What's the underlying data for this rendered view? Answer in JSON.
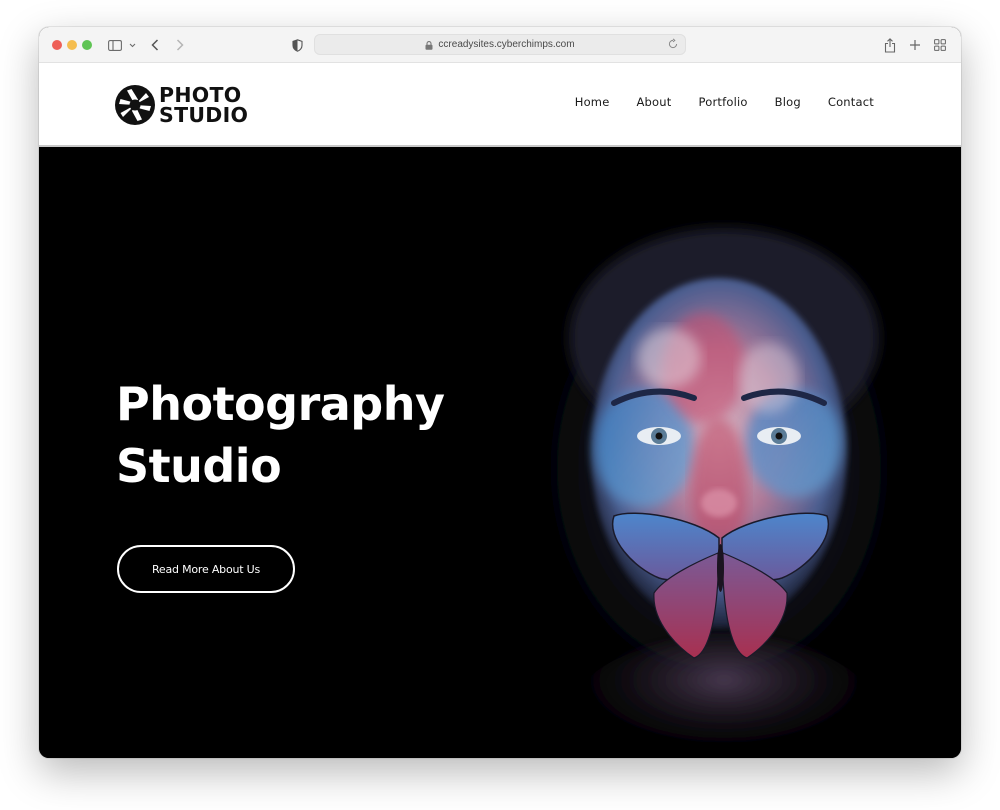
{
  "browser": {
    "url": "ccreadysites.cyberchimps.com",
    "icons": {
      "sidebar": "sidebar-icon",
      "back": "chevron-left-icon",
      "forward": "chevron-right-icon",
      "privacy": "shield-icon",
      "lock": "lock-icon",
      "reload": "reload-icon",
      "share": "share-icon",
      "new_tab": "plus-icon",
      "tab_overview": "grid-icon"
    }
  },
  "header": {
    "logo": {
      "line1": "PHOTO",
      "line2": "STUDIO",
      "icon": "camera-aperture-icon"
    },
    "nav": [
      {
        "label": "Home"
      },
      {
        "label": "About"
      },
      {
        "label": "Portfolio"
      },
      {
        "label": "Blog"
      },
      {
        "label": "Contact"
      }
    ]
  },
  "hero": {
    "title_line1": "Photography",
    "title_line2": "Studio",
    "button_label": "Read More About Us",
    "image_alt": "Portrait of a woman with blue and red painted face and a blue butterfly over her mouth"
  },
  "colors": {
    "hero_background": "#000000",
    "header_background": "#ffffff",
    "text_dark": "#111111",
    "text_light": "#ffffff"
  }
}
